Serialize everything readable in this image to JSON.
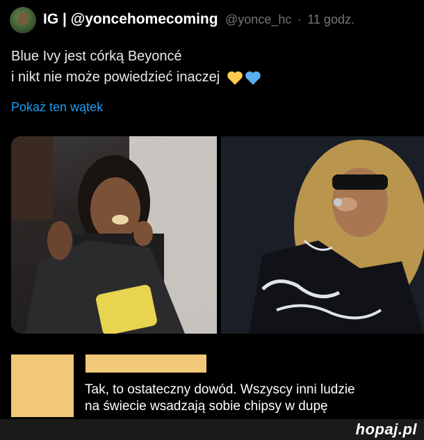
{
  "tweet": {
    "display_name": "IG | @yoncehomecoming",
    "handle": "@yonce_hc",
    "separator": "·",
    "time": "11 godz.",
    "text_line1": "Blue Ivy jest córką Beyoncé",
    "text_line2": "i nikt nie może powiedzieć inaczej",
    "hearts": [
      "yellow-heart-icon",
      "blue-heart-icon"
    ],
    "show_thread": "Pokaż ten wątek",
    "colors": {
      "link": "#1d9bf0",
      "muted": "#71767b",
      "heart_yellow": "#ffcc4d",
      "heart_blue": "#5dadec"
    }
  },
  "reply": {
    "line1": "Tak, to ostateczny dowód. Wszyscy inni ludzie",
    "line2": "na świecie wsadzają sobie chipsy w dupę",
    "redaction_color": "#f0c878"
  },
  "footer": {
    "brand": "hopaj.pl"
  }
}
